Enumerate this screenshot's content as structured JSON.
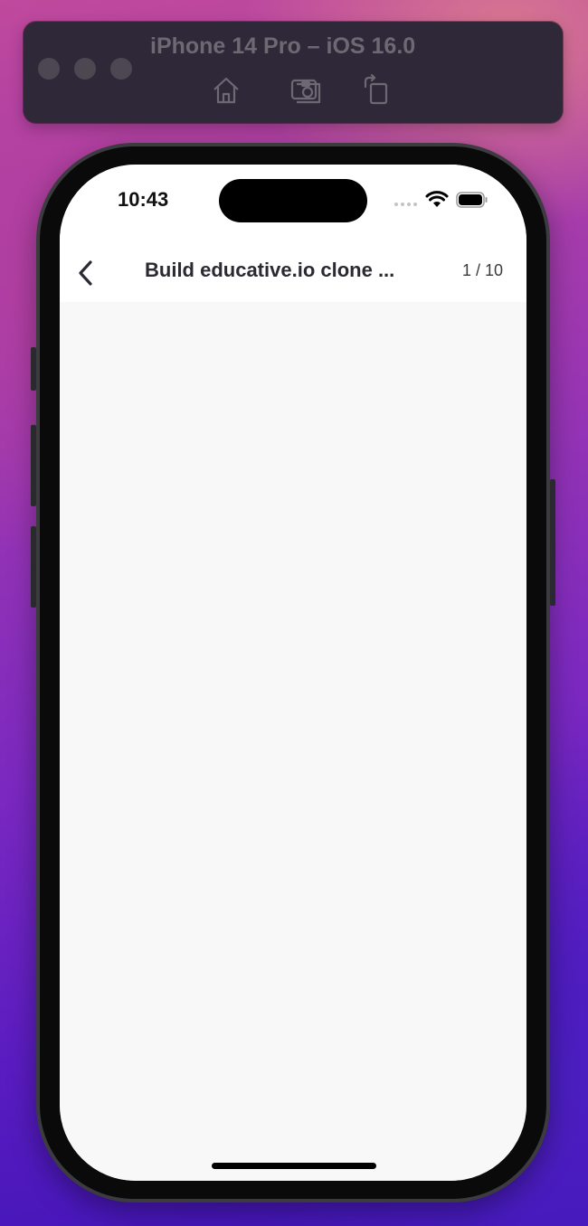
{
  "simulator": {
    "title": "iPhone 14 Pro – iOS 16.0",
    "tools": [
      "home-icon",
      "screenshot-icon",
      "rotate-icon"
    ]
  },
  "status_bar": {
    "time": "10:43",
    "icons": [
      "cellular-signal-icon",
      "wifi-icon",
      "battery-icon"
    ]
  },
  "nav": {
    "back_icon": "chevron-left-icon",
    "title": "Build educative.io clone ...",
    "counter": "1 / 10"
  },
  "colors": {
    "screen_background": "#f8f8f8",
    "nav_background": "#ffffff",
    "title_text": "#2b2a33",
    "simulator_bar": "#2f2838"
  }
}
